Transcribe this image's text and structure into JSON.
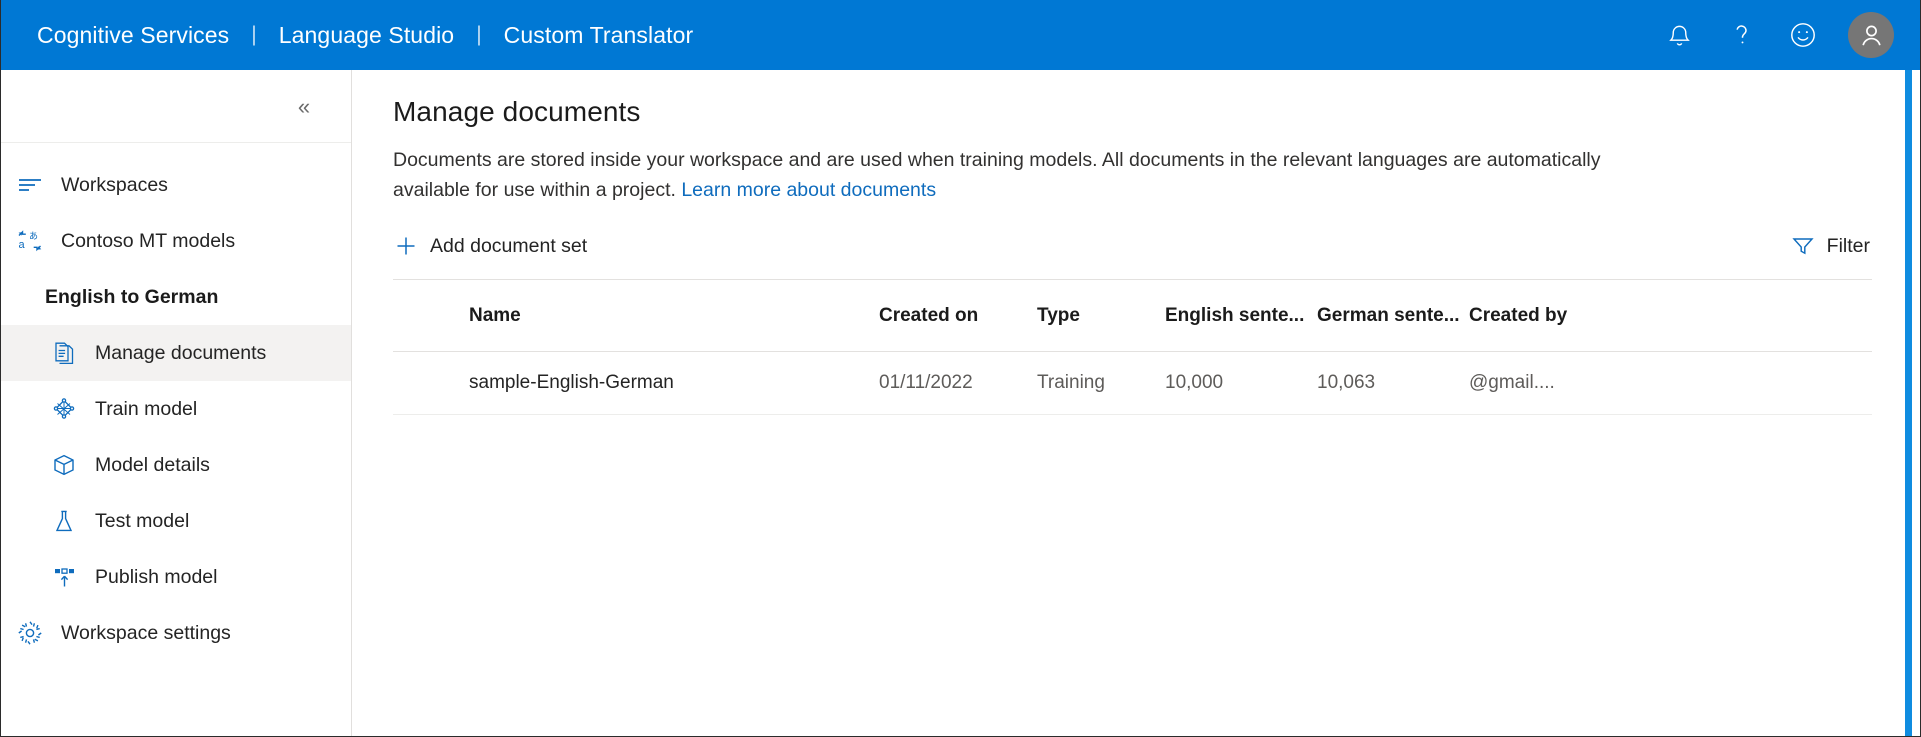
{
  "topbar": {
    "brand_items": [
      "Cognitive Services",
      "Language Studio",
      "Custom Translator"
    ],
    "separator": "|",
    "icons": [
      {
        "name": "notifications-icon",
        "glyph": "bell"
      },
      {
        "name": "help-icon",
        "glyph": "question"
      },
      {
        "name": "feedback-icon",
        "glyph": "smiley"
      }
    ],
    "avatar_label": "",
    "background_color": "#0078d4"
  },
  "sidebar": {
    "collapse_label": "«",
    "items": [
      {
        "label": "Workspaces",
        "icon": "workspaces-icon",
        "level": "top",
        "selected": false
      },
      {
        "label": "Contoso MT models",
        "icon": "translator-models-icon",
        "level": "top",
        "selected": false
      },
      {
        "label": "English to German",
        "icon": "",
        "level": "group-title",
        "selected": false
      },
      {
        "label": "Manage documents",
        "icon": "document-icon",
        "level": "sub",
        "selected": true
      },
      {
        "label": "Train model",
        "icon": "train-model-icon",
        "level": "sub",
        "selected": false
      },
      {
        "label": "Model details",
        "icon": "box-icon",
        "level": "sub",
        "selected": false
      },
      {
        "label": "Test model",
        "icon": "flask-icon",
        "level": "sub",
        "selected": false
      },
      {
        "label": "Publish model",
        "icon": "publish-icon",
        "level": "sub",
        "selected": false
      },
      {
        "label": "Workspace settings",
        "icon": "gear-icon",
        "level": "top",
        "selected": false
      }
    ]
  },
  "main": {
    "title": "Manage documents",
    "description_before": "Documents are stored inside your workspace and are used when training models. All documents in the relevant languages are automatically available for use within a project. ",
    "description_link": "Learn more about documents",
    "add_button_label": "Add document set",
    "add_button_icon": "plus-icon",
    "filter_button_label": "Filter",
    "filter_button_icon": "filter-icon",
    "accent_color": "#0f6cbd"
  },
  "table": {
    "columns": [
      "Name",
      "Created on",
      "Type",
      "English sente...",
      "German sente...",
      "Created by"
    ],
    "rows": [
      {
        "name": "sample-English-German",
        "created_on": "01/11/2022",
        "type": "Training",
        "english_sentences": "10,000",
        "german_sentences": "10,063",
        "created_by": "@gmail...."
      }
    ]
  }
}
